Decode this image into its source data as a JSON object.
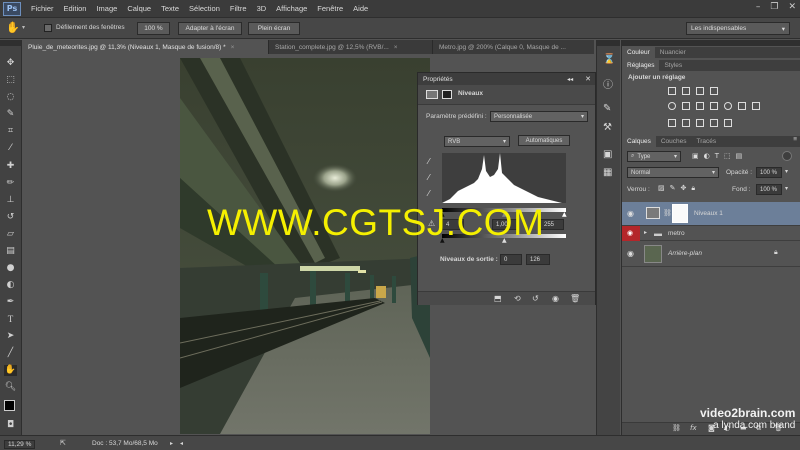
{
  "app": {
    "logo": "Ps"
  },
  "menu": [
    "Fichier",
    "Edition",
    "Image",
    "Calque",
    "Texte",
    "Sélection",
    "Filtre",
    "3D",
    "Affichage",
    "Fenêtre",
    "Aide"
  ],
  "options": {
    "scroll_all_label": "Défilement des fenêtres",
    "zoom_button": "100 %",
    "fit_button": "Adapter à l'écran",
    "fullscreen_button": "Plein écran",
    "workspace": "Les indispensables"
  },
  "tabs": [
    {
      "label": "Pluie_de_meteorites.jpg @ 11,3% (Niveaux 1, Masque de fusion/8) *",
      "close": "×"
    },
    {
      "label": "Station_complete.jpg @ 12,5% (RVB/...",
      "close": "×"
    },
    {
      "label": "Metro.jpg @ 200% (Calque 0, Masque de ...",
      "close": ""
    }
  ],
  "properties": {
    "title": "Propriétés",
    "panel_name": "Niveaux",
    "preset_label": "Paramètre prédéfini :",
    "preset_value": "Personnalisée",
    "channel": "RVB",
    "auto_button": "Automatiques",
    "input_shadow": "4",
    "input_mid": "1,00",
    "input_high": "255",
    "output_label": "Niveaux de sortie :",
    "output_low": "0",
    "output_high": "126"
  },
  "panels": {
    "color_tabs": [
      "Couleur",
      "Nuancier"
    ],
    "adjust_tabs": [
      "Réglages",
      "Styles"
    ],
    "adjust_title": "Ajouter un réglage",
    "layer_tabs": [
      "Calques",
      "Couches",
      "Tracés"
    ],
    "kind_filter": "Type",
    "blend_mode": "Normal",
    "opacity_label": "Opacité :",
    "opacity_value": "100 %",
    "lock_label": "Verrou :",
    "fill_label": "Fond :",
    "fill_value": "100 %",
    "layers": [
      {
        "name": "Niveaux 1"
      },
      {
        "name": "metro"
      },
      {
        "name": "Arrière-plan"
      }
    ]
  },
  "status": {
    "zoom": "11,29 %",
    "doc": "Doc : 53,7 Mo/68,5 Mo"
  },
  "watermark": "WWW.CGTSJ.COM",
  "brand": {
    "line1": "video2brain.com",
    "line2": "a lynda.com brand"
  },
  "icons": {
    "eye": "eye-icon",
    "folder": "folder-icon",
    "lock": "lock-icon"
  }
}
